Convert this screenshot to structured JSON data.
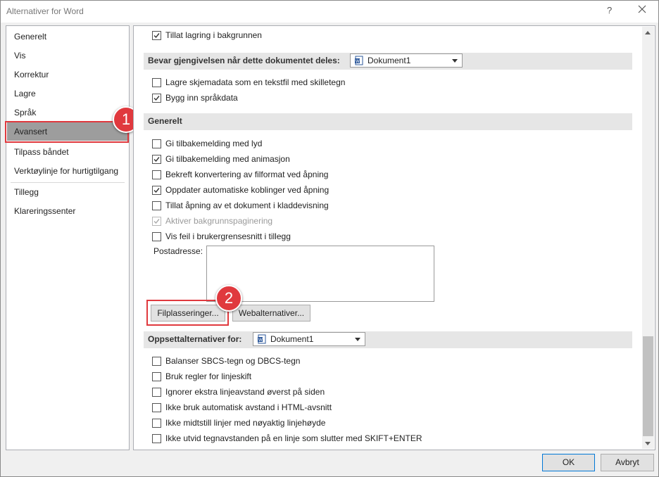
{
  "window": {
    "title": "Alternativer for Word",
    "help": "?"
  },
  "nav": {
    "items": [
      "Generelt",
      "Vis",
      "Korrektur",
      "Lagre",
      "Språk",
      "Avansert",
      "Tilpass båndet",
      "Verktøylinje for hurtigtilgang",
      "Tillegg",
      "Klareringssenter"
    ],
    "selected": "Avansert"
  },
  "callouts": {
    "one": "1",
    "two": "2"
  },
  "content": {
    "top_checkbox": {
      "label": "Tillat lagring i bakgrunnen",
      "checked": true
    },
    "section_preserve": {
      "label": "Bevar gjengivelsen når dette dokumentet deles:",
      "select_value": "Dokument1"
    },
    "preserve_options": [
      {
        "label": "Lagre skjemadata som en tekstfil med skilletegn",
        "checked": false
      },
      {
        "label": "Bygg inn språkdata",
        "checked": true
      }
    ],
    "section_general": {
      "label": "Generelt"
    },
    "general_options": [
      {
        "label": "Gi tilbakemelding med lyd",
        "checked": false,
        "disabled": false
      },
      {
        "label": "Gi tilbakemelding med animasjon",
        "checked": true,
        "disabled": false
      },
      {
        "label": "Bekreft konvertering av filformat ved åpning",
        "checked": false,
        "disabled": false
      },
      {
        "label": "Oppdater automatiske koblinger ved åpning",
        "checked": true,
        "disabled": false
      },
      {
        "label": "Tillat åpning av et dokument i kladdevisning",
        "checked": false,
        "disabled": false
      },
      {
        "label": "Aktiver bakgrunnspaginering",
        "checked": true,
        "disabled": true
      },
      {
        "label": "Vis feil i brukergrensesnitt i tillegg",
        "checked": false,
        "disabled": false
      }
    ],
    "postal_label": "Postadresse:",
    "postal_value": "",
    "file_locations_button": "Filplasseringer...",
    "web_options_button": "Webalternativer...",
    "section_layout": {
      "label": "Oppsettalternativer for:",
      "select_value": "Dokument1"
    },
    "layout_options": [
      {
        "label": "Balanser SBCS-tegn og DBCS-tegn",
        "checked": false
      },
      {
        "label": "Bruk regler for linjeskift",
        "checked": false
      },
      {
        "label": "Ignorer ekstra linjeavstand øverst på siden",
        "checked": false
      },
      {
        "label": "Ikke bruk automatisk avstand i HTML-avsnitt",
        "checked": false
      },
      {
        "label": "Ikke midtstill linjer med nøyaktig linjehøyde",
        "checked": false
      },
      {
        "label": "Ikke utvid tegnavstanden på en linje som slutter med SKIFT+ENTER",
        "checked": false
      }
    ]
  },
  "footer": {
    "ok": "OK",
    "cancel": "Avbryt"
  },
  "colors": {
    "accent_red": "#e0393e",
    "selected_nav": "#9d9d9d",
    "section_bg": "#e6e6e6",
    "ok_border": "#0078d7"
  }
}
